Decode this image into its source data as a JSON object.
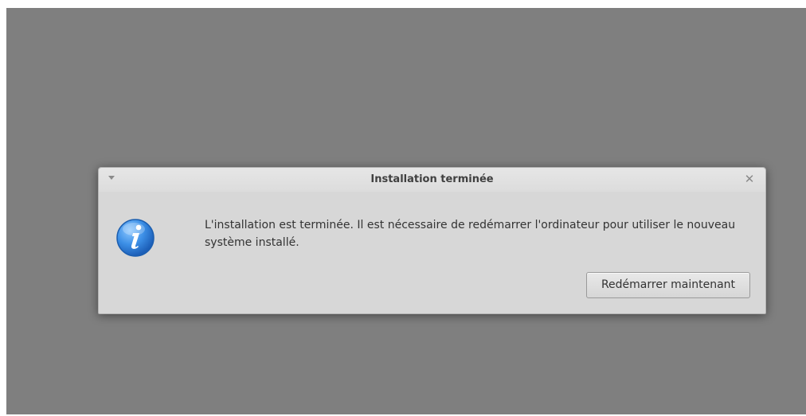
{
  "dialog": {
    "title": "Installation terminée",
    "message": "L'installation est terminée. Il est nécessaire de redémarrer l'ordinateur pour utiliser le nouveau système installé.",
    "restart_button_label": "Redémarrer maintenant",
    "window_menu_icon": "chevron-down-icon",
    "close_icon": "close-icon",
    "status_icon": "info-icon"
  },
  "colors": {
    "desktop_background": "#7f7f7f",
    "dialog_background": "#d7d7d7",
    "info_icon_blue": "#2f7fd6"
  }
}
